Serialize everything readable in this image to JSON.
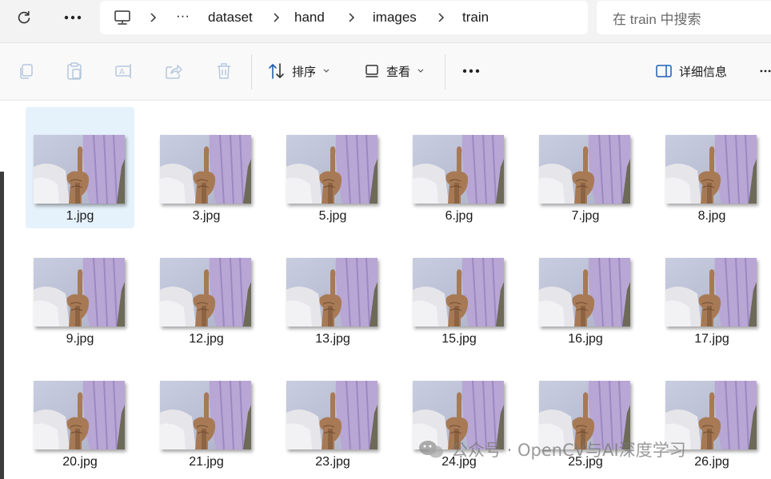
{
  "nav": {
    "refresh_icon": "refresh-icon",
    "more_icon": "more-horizontal-icon"
  },
  "breadcrumb": {
    "root_icon": "this-pc-icon",
    "overflow": "···",
    "items": [
      "dataset",
      "hand",
      "images",
      "train"
    ]
  },
  "search": {
    "placeholder": "在 train 中搜索"
  },
  "toolbar": {
    "copy_icon": "copy-icon",
    "paste_icon": "paste-icon",
    "rename_icon": "rename-icon",
    "share_icon": "share-icon",
    "delete_icon": "delete-icon",
    "sort_label": "排序",
    "view_label": "查看",
    "more_icon": "more-horizontal-icon",
    "details_label": "详细信息"
  },
  "files": [
    {
      "name": "1.jpg",
      "selected": true
    },
    {
      "name": "3.jpg"
    },
    {
      "name": "5.jpg"
    },
    {
      "name": "6.jpg"
    },
    {
      "name": "7.jpg"
    },
    {
      "name": "8.jpg"
    },
    {
      "name": "9.jpg"
    },
    {
      "name": "12.jpg"
    },
    {
      "name": "13.jpg"
    },
    {
      "name": "15.jpg"
    },
    {
      "name": "16.jpg"
    },
    {
      "name": "17.jpg"
    },
    {
      "name": "20.jpg"
    },
    {
      "name": "21.jpg"
    },
    {
      "name": "23.jpg"
    },
    {
      "name": "24.jpg"
    },
    {
      "name": "25.jpg"
    },
    {
      "name": "26.jpg"
    }
  ],
  "watermark": {
    "text": "公众号 · OpenCV与AI深度学习"
  },
  "colors": {
    "selected_bg": "#e5f1fb",
    "curtain": "#b8a6d4",
    "skin": "#a77a55"
  }
}
